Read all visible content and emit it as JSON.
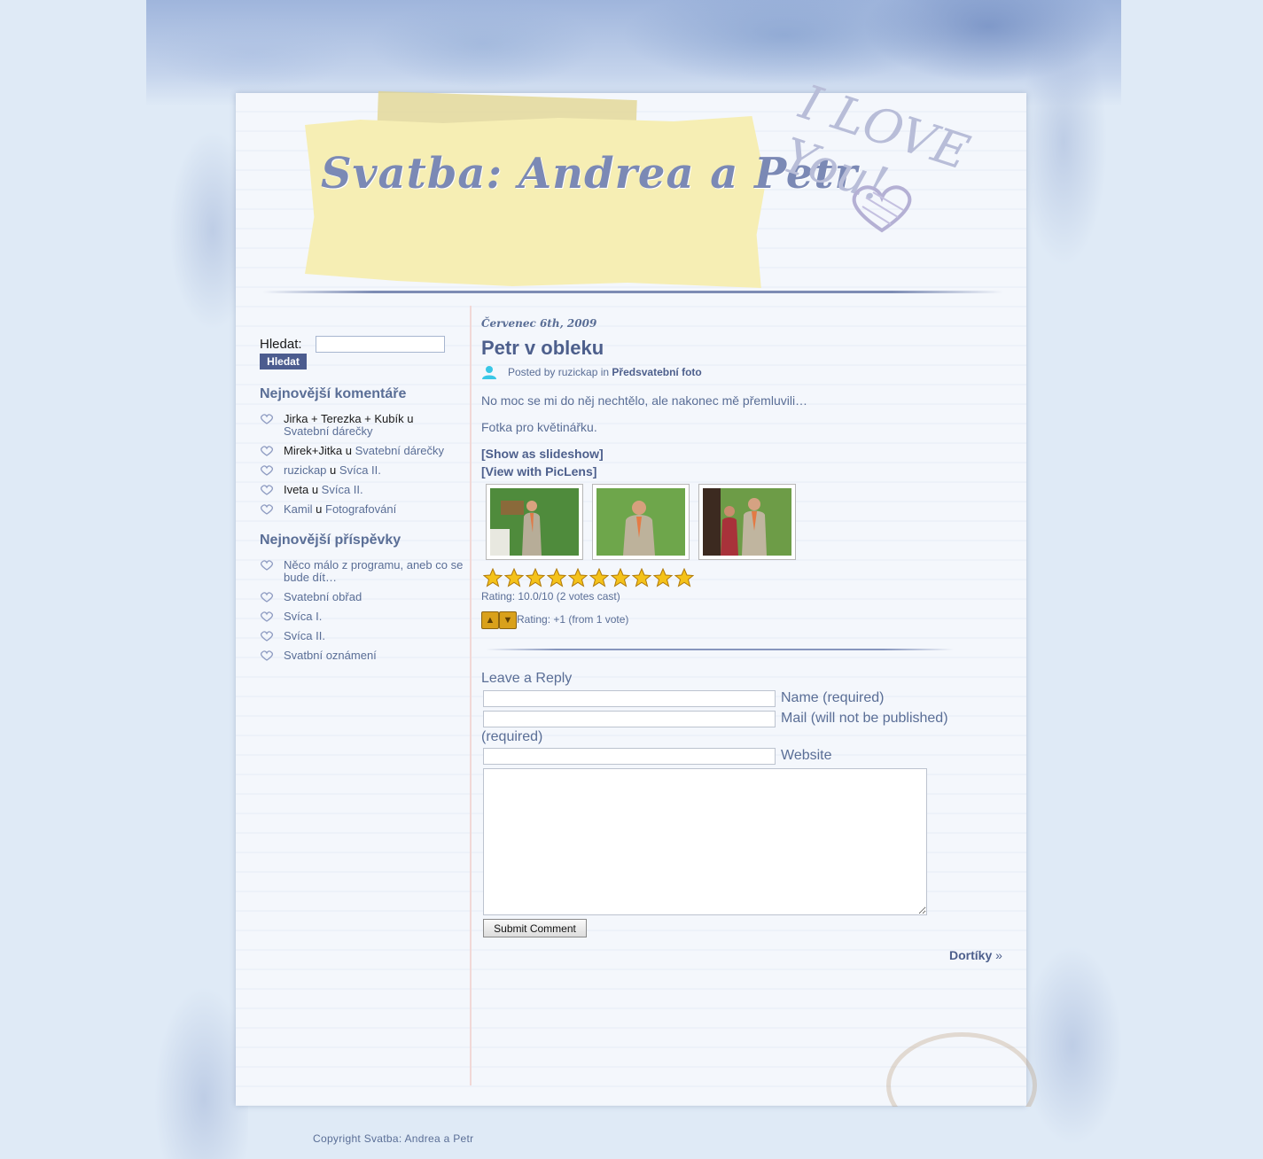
{
  "site": {
    "title": "Svatba: Andrea a Petr",
    "decor_text": "I LOVE You!"
  },
  "search": {
    "label": "Hledat:",
    "value": "",
    "button": "Hledat"
  },
  "sidebar": {
    "comments_heading": "Nejnovější komentáře",
    "comments": [
      {
        "author": "Jirka + Terezka + Kubík",
        "sep": "u",
        "post": "Svatební dárečky"
      },
      {
        "author": "Mirek+Jitka",
        "sep": "u",
        "post": "Svatební dárečky"
      },
      {
        "author": "ruzickap",
        "sep": "u",
        "post": "Svíca II."
      },
      {
        "author": "Iveta",
        "sep": "u",
        "post": "Svíca II."
      },
      {
        "author": "Kamil",
        "sep": "u",
        "post": "Fotografování"
      }
    ],
    "posts_heading": "Nejnovější příspěvky",
    "posts": [
      "Něco málo z programu, aneb co se bude dít…",
      "Svatební obřad",
      "Svíca I.",
      "Svíca II.",
      "Svatbní oznámení"
    ]
  },
  "post": {
    "date": "Červenec 6th, 2009",
    "title": "Petr v obleku",
    "meta_prefix": "Posted by ruzickap in",
    "category": "Předsvatební foto",
    "paragraphs": [
      "No moc se mi do něj nechtělo, ale nakonec mě přemluvili…",
      "Fotka pro květinářku."
    ],
    "slideshow_link": "[Show as slideshow]",
    "piclens_link": "[View with PicLens]",
    "thumbnail_count": 3,
    "star_rating": {
      "stars_filled": 10,
      "stars_total": 10,
      "text": "Rating: 10.0/10 (2 votes cast)"
    },
    "thumb_rating": {
      "up_icon": "thumbs-up-icon",
      "down_icon": "thumbs-down-icon",
      "text": "Rating: +1 (from 1 vote)"
    }
  },
  "reply": {
    "heading": "Leave a Reply",
    "name_label": "Name (required)",
    "mail_label_line1": "Mail (will not be published)",
    "mail_label_line2": "(required)",
    "website_label": "Website",
    "name_value": "",
    "mail_value": "",
    "website_value": "",
    "comment_value": "",
    "submit_label": "Submit Comment"
  },
  "navigation": {
    "next_label": "Dortíky",
    "next_arrow": "»"
  },
  "footer": {
    "text": "Copyright Svatba: Andrea a Petr"
  },
  "colors": {
    "page_bg": "#dfeaf6",
    "link": "#5a6e96",
    "title": "#4d5f8c",
    "note": "#f6eeb4",
    "button": "#4c5c8f"
  }
}
